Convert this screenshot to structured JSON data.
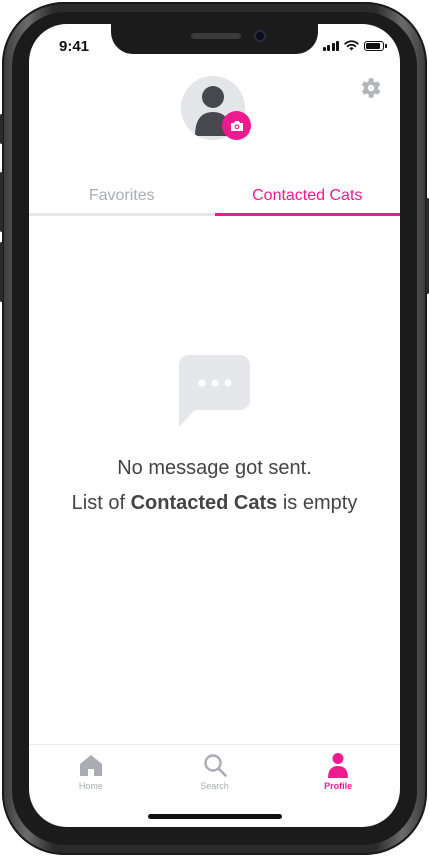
{
  "status_bar": {
    "time": "9:41"
  },
  "profile": {
    "avatar_icon": "user-avatar-icon",
    "badge_icon": "camera-icon",
    "settings_icon": "gear-icon"
  },
  "tabs": [
    {
      "label": "Favorites",
      "active": false
    },
    {
      "label": "Contacted Cats",
      "active": true
    }
  ],
  "empty_state": {
    "icon": "chat-bubble-icon",
    "line1": "No message got sent.",
    "line2_prefix": "List of ",
    "line2_bold": "Contacted Cats",
    "line2_suffix": " is empty"
  },
  "bottom_nav": [
    {
      "label": "Home",
      "icon": "home-icon",
      "active": false
    },
    {
      "label": "Search",
      "icon": "search-icon",
      "active": false
    },
    {
      "label": "Profile",
      "icon": "person-icon",
      "active": true
    }
  ],
  "colors": {
    "accent": "#ef1a8f",
    "inactive": "#a9acb3",
    "text": "#444444"
  }
}
